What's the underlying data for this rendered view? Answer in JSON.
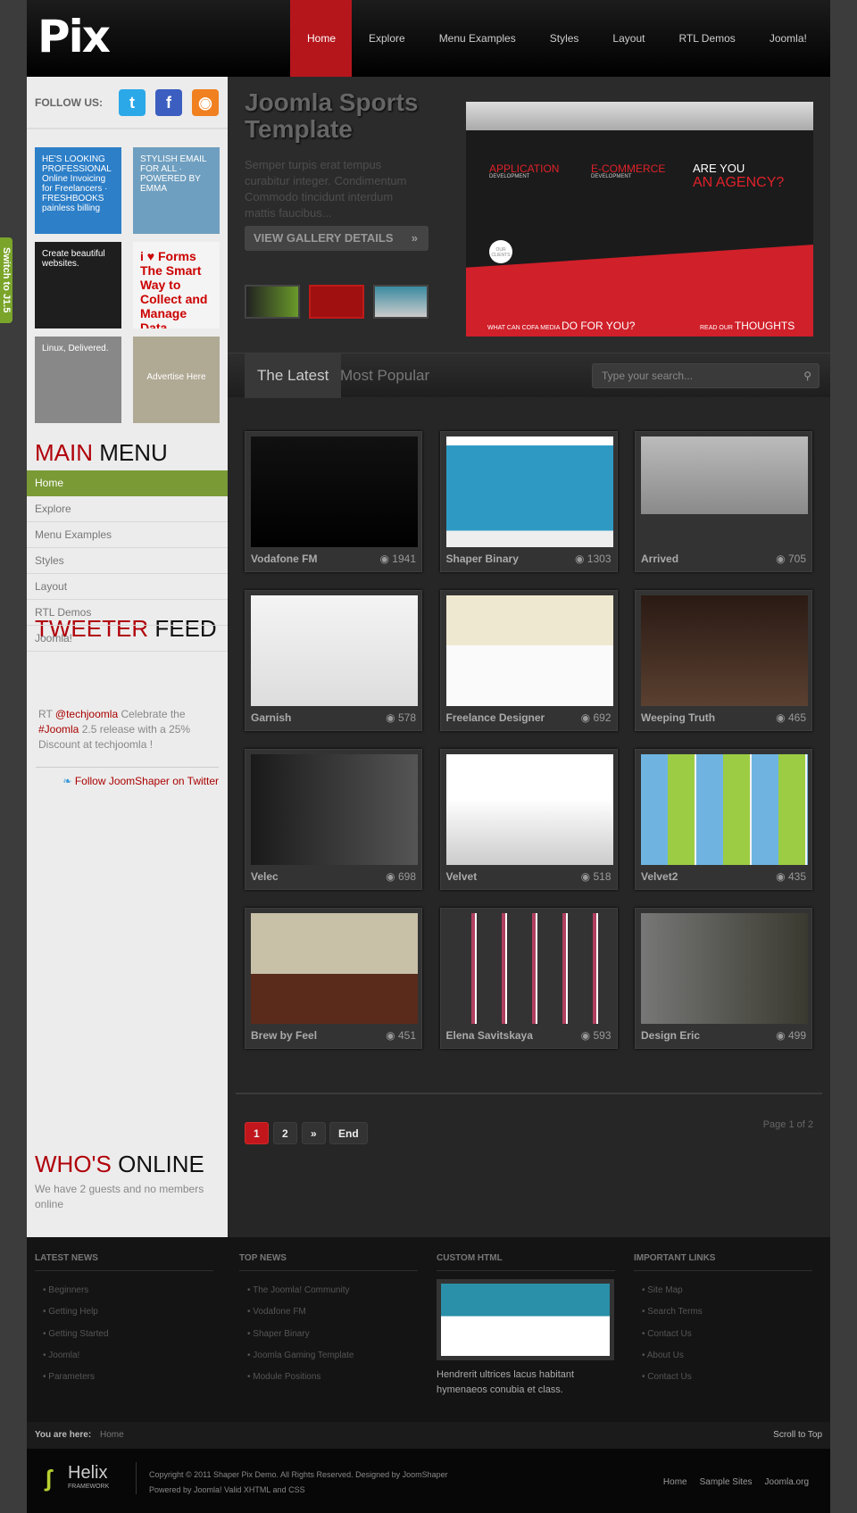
{
  "switch_label": "Switch to J1.5",
  "logo": "Pix",
  "nav": [
    "Home",
    "Explore",
    "Menu Examples",
    "Styles",
    "Layout",
    "RTL Demos",
    "Joomla!"
  ],
  "sidebar": {
    "follow_label": "FOLLOW US:",
    "social": [
      {
        "icon": "twitter-icon",
        "glyph": "t",
        "color": "#2aa8e8"
      },
      {
        "icon": "facebook-icon",
        "glyph": "f",
        "color": "#3b5ec0"
      },
      {
        "icon": "rss-icon",
        "glyph": "◉",
        "color": "#f08020"
      }
    ],
    "ads": [
      {
        "text": "HE'S LOOKING PROFESSIONAL Online Invoicing for Freelancers · FRESHBOOKS painless billing",
        "bg": "#2d7fc8"
      },
      {
        "text": "STYLISH EMAIL FOR ALL · POWERED BY EMMA",
        "bg": "#6f9fc0"
      },
      {
        "text": "Create beautiful websites.",
        "bg": "#1e1e1e"
      },
      {
        "text": "i ♥ Forms The Smart Way to Collect and Manage Data",
        "bg": "#f4f4f4"
      },
      {
        "text": "Linux, Delivered.",
        "bg": "#888"
      },
      {
        "text": "Advertise Here",
        "bg": "#b0a994"
      }
    ],
    "main_menu": {
      "title_red": "MAIN",
      "title": "MENU",
      "items": [
        "Home",
        "Explore",
        "Menu Examples",
        "Styles",
        "Layout",
        "RTL Demos",
        "Joomla!"
      ]
    },
    "tweeter": {
      "title_red": "TWEETER",
      "title": "FEED",
      "rt": "RT ",
      "handle": "@techjoomla",
      "t1": " Celebrate the ",
      "tag": "#Joomla",
      "t2": " 2.5 release with a 25% Discount at techjoomla !",
      "follow": "Follow JoomShaper on Twitter"
    },
    "online": {
      "title_red": "WHO'S",
      "title": "ONLINE",
      "text": "We have 2 guests and no members online"
    }
  },
  "slideshow": {
    "title": "Joomla Sports Template",
    "desc": "Semper turpis erat tempus curabitur integer. Condimentum Commodo tincidunt interdum mattis faucibus...",
    "button": "VIEW GALLERY DETAILS",
    "shot": {
      "app": "APPLICATION",
      "app_sub": "DEVELOPMENT",
      "ecom": "E-COMMERCE",
      "ecom_sub": "DEVELOPMENT",
      "are": "ARE YOU",
      "agency": "AN AGENCY?",
      "clients": "OUR CLIENTS",
      "q1": "WHAT CAN COFA MEDIA",
      "q2": "DO FOR YOU?",
      "r1": "READ OUR",
      "r2": "THOUGHTS"
    }
  },
  "tabs": [
    "The Latest",
    "Most Popular"
  ],
  "search_placeholder": "Type your search...",
  "gallery": [
    {
      "name": "Vodafone FM",
      "views": "1941",
      "bg": "linear-gradient(#111,#000)"
    },
    {
      "name": "Shaper Binary",
      "views": "1303",
      "bg": "linear-gradient(#fff 8%,#2e9ac4 8%,#2e9ac4 85%,#eee 85%)"
    },
    {
      "name": "Arrived",
      "views": "705",
      "bg": "linear-gradient(#bbb,#8a8a8a 70%,#333 70%)"
    },
    {
      "name": "Garnish",
      "views": "578",
      "bg": "linear-gradient(#f4f4f4,#ddd)"
    },
    {
      "name": "Freelance Designer",
      "views": "692",
      "bg": "linear-gradient(#efe8d0 45%,#fafafa 45%)"
    },
    {
      "name": "Weeping Truth",
      "views": "465",
      "bg": "linear-gradient(#2a1a14,#5a4030)"
    },
    {
      "name": "Velec",
      "views": "698",
      "bg": "linear-gradient(90deg,#1a1a1a,#555)"
    },
    {
      "name": "Velvet",
      "views": "518",
      "bg": "linear-gradient(#fff 40%,#ccc)"
    },
    {
      "name": "Velvet2",
      "views": "435",
      "bg": "repeating-linear-gradient(90deg,#6fb4e0 0 30px,#9ccc44 30px 60px,#f3f3f3 60px 62px)"
    },
    {
      "name": "Brew by Feel",
      "views": "451",
      "bg": "linear-gradient(#c9c0a8 55%,#5a2a1a 55%)"
    },
    {
      "name": "Elena Savitskaya",
      "views": "593",
      "bg": "repeating-linear-gradient(90deg,#333 0 28px,#b04060 28px 32px,#fff 32px 34px)"
    },
    {
      "name": "Design Eric",
      "views": "499",
      "bg": "linear-gradient(90deg,#777,#3a3a30)"
    }
  ],
  "pagination": {
    "pages": [
      "1",
      "2",
      "»",
      "End"
    ],
    "current": "1",
    "status": "Page 1 of 2"
  },
  "footer": {
    "columns": [
      {
        "title": "LATEST NEWS",
        "items": [
          "Beginners",
          "Getting Help",
          "Getting Started",
          "Joomla!",
          "Parameters"
        ]
      },
      {
        "title": "TOP NEWS",
        "items": [
          "The Joomla! Community",
          "Vodafone FM",
          "Shaper Binary",
          "Joomla Gaming Template",
          "Module Positions"
        ]
      },
      {
        "title": "CUSTOM HTML",
        "text": "Hendrerit ultrices lacus habitant hymenaeos conubia et class."
      },
      {
        "title": "IMPORTANT LINKS",
        "items": [
          "Site Map",
          "Search Terms",
          "Contact Us",
          "About Us",
          "Contact Us"
        ]
      }
    ],
    "you_are_here": "You are here:",
    "crumb": "Home",
    "scroll_top": "Scroll to Top",
    "helix": "Helix",
    "helix_sub": "FRAMEWORK",
    "copyright": "Copyright © 2011 Shaper Pix Demo. All Rights Reserved. Designed by JoomShaper",
    "powered": "Powered by Joomla! Valid XHTML and CSS",
    "links": [
      "Home",
      "Sample Sites",
      "Joomla.org"
    ]
  },
  "colors": {
    "accent_red": "#b5161c",
    "menu_green": "#7a9a36"
  }
}
